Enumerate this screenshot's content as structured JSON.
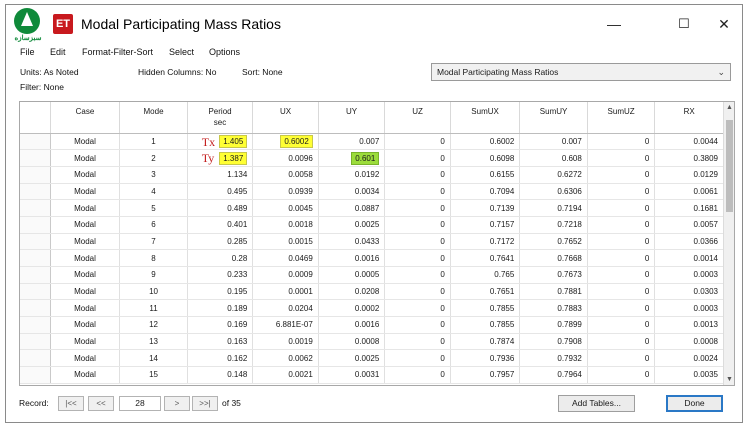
{
  "window": {
    "logo_text": "سبزسازه",
    "app_icon": "ET",
    "title": "Modal Participating Mass Ratios",
    "controls": {
      "minimize": "—",
      "maximize": "☐",
      "close": "✕"
    }
  },
  "menu": [
    "File",
    "Edit",
    "Format-Filter-Sort",
    "Select",
    "Options"
  ],
  "info": {
    "units": "Units:  As Noted",
    "hidden_columns": "Hidden Columns:  No",
    "sort": "Sort:  None",
    "filter": "Filter:  None"
  },
  "table_select": {
    "value": "Modal Participating Mass Ratios",
    "icon": "chevron-down-icon"
  },
  "columns": [
    "Case",
    "Mode",
    "Period\nsec",
    "UX",
    "UY",
    "UZ",
    "SumUX",
    "SumUY",
    "SumUZ",
    "RX"
  ],
  "annotations": {
    "tx": "Tx",
    "ty": "Ty"
  },
  "highlight_colors": {
    "yellow": "#ffff33",
    "green": "#9bdc3a",
    "annotation_red": "#c31d1d"
  },
  "rows": [
    [
      "Modal",
      "1",
      "1.405",
      "0.6002",
      "0.007",
      "0",
      "0.6002",
      "0.007",
      "0",
      "0.0044"
    ],
    [
      "Modal",
      "2",
      "1.387",
      "0.0096",
      "0.601",
      "0",
      "0.6098",
      "0.608",
      "0",
      "0.3809"
    ],
    [
      "Modal",
      "3",
      "1.134",
      "0.0058",
      "0.0192",
      "0",
      "0.6155",
      "0.6272",
      "0",
      "0.0129"
    ],
    [
      "Modal",
      "4",
      "0.495",
      "0.0939",
      "0.0034",
      "0",
      "0.7094",
      "0.6306",
      "0",
      "0.0061"
    ],
    [
      "Modal",
      "5",
      "0.489",
      "0.0045",
      "0.0887",
      "0",
      "0.7139",
      "0.7194",
      "0",
      "0.1681"
    ],
    [
      "Modal",
      "6",
      "0.401",
      "0.0018",
      "0.0025",
      "0",
      "0.7157",
      "0.7218",
      "0",
      "0.0057"
    ],
    [
      "Modal",
      "7",
      "0.285",
      "0.0015",
      "0.0433",
      "0",
      "0.7172",
      "0.7652",
      "0",
      "0.0366"
    ],
    [
      "Modal",
      "8",
      "0.28",
      "0.0469",
      "0.0016",
      "0",
      "0.7641",
      "0.7668",
      "0",
      "0.0014"
    ],
    [
      "Modal",
      "9",
      "0.233",
      "0.0009",
      "0.0005",
      "0",
      "0.765",
      "0.7673",
      "0",
      "0.0003"
    ],
    [
      "Modal",
      "10",
      "0.195",
      "0.0001",
      "0.0208",
      "0",
      "0.7651",
      "0.7881",
      "0",
      "0.0303"
    ],
    [
      "Modal",
      "11",
      "0.189",
      "0.0204",
      "0.0002",
      "0",
      "0.7855",
      "0.7883",
      "0",
      "0.0003"
    ],
    [
      "Modal",
      "12",
      "0.169",
      "6.881E-07",
      "0.0016",
      "0",
      "0.7855",
      "0.7899",
      "0",
      "0.0013"
    ],
    [
      "Modal",
      "13",
      "0.163",
      "0.0019",
      "0.0008",
      "0",
      "0.7874",
      "0.7908",
      "0",
      "0.0008"
    ],
    [
      "Modal",
      "14",
      "0.162",
      "0.0062",
      "0.0025",
      "0",
      "0.7936",
      "0.7932",
      "0",
      "0.0024"
    ],
    [
      "Modal",
      "15",
      "0.148",
      "0.0021",
      "0.0031",
      "0",
      "0.7957",
      "0.7964",
      "0",
      "0.0035"
    ]
  ],
  "footer": {
    "record_label": "Record:",
    "first": "|<<",
    "prev": "<<",
    "record_value": "28",
    "next": ">",
    "last": ">>|",
    "of_total": "of 35",
    "add_tables": "Add Tables...",
    "done": "Done"
  }
}
